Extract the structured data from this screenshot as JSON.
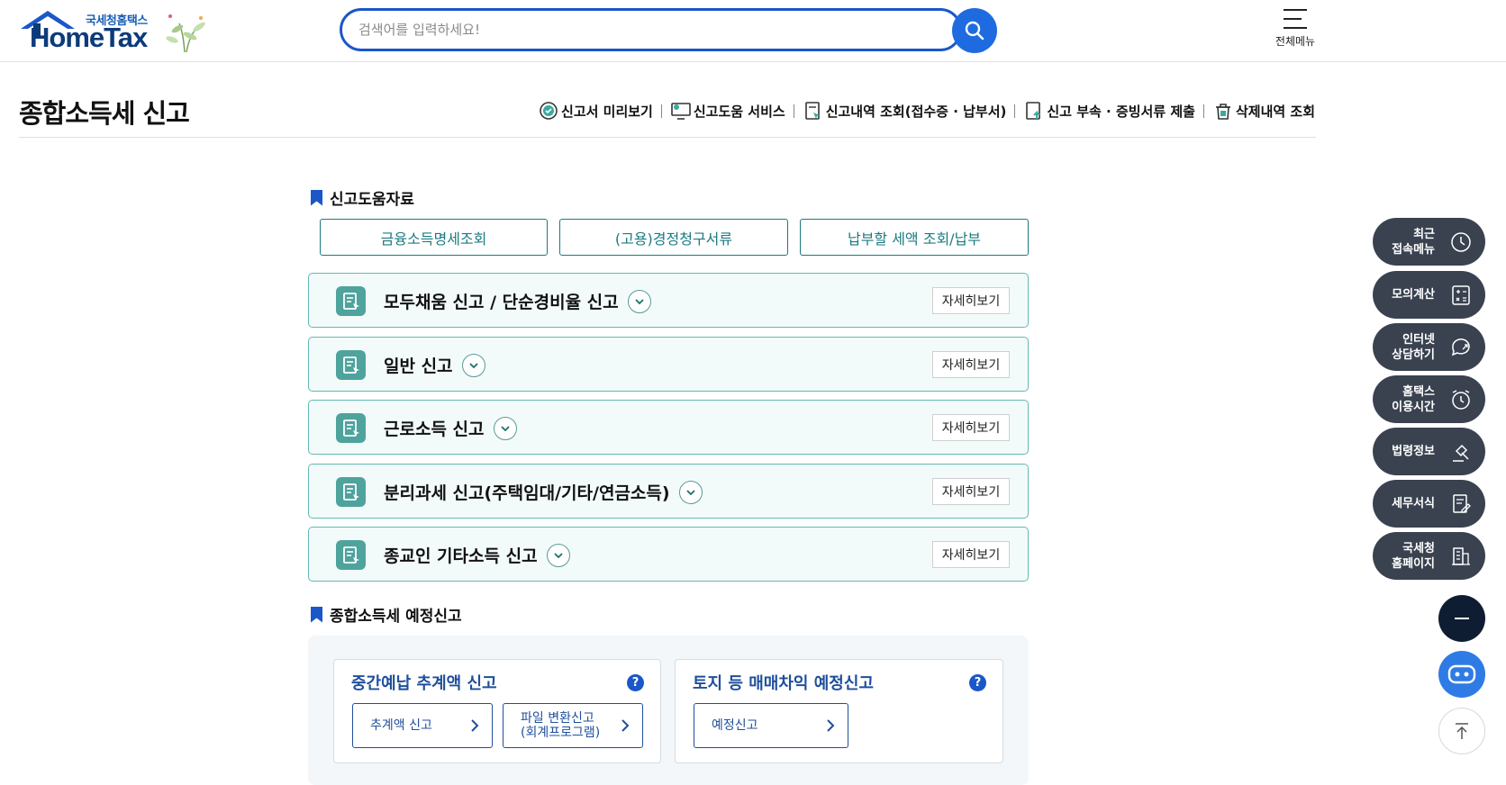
{
  "header": {
    "logo_top_text": "국세청홈택스",
    "logo_main_text": "HomeTax",
    "search_placeholder": "검색어를 입력하세요!",
    "all_menu_label": "전체메뉴"
  },
  "page": {
    "title": "종합소득세 신고",
    "quick_links": [
      {
        "label": "신고서 미리보기",
        "icon": "check-circle-icon"
      },
      {
        "label": "신고도움 서비스",
        "icon": "monitor-help-icon"
      },
      {
        "label": "신고내역 조회(접수증 · 납부서)",
        "icon": "document-search-icon"
      },
      {
        "label": "신고 부속 · 증빙서류 제출",
        "icon": "document-upload-icon"
      },
      {
        "label": "삭제내역 조회",
        "icon": "trash-icon"
      }
    ]
  },
  "help_section": {
    "heading": "신고도움자료",
    "buttons": [
      "금융소득명세조회",
      "(고용)경정청구서류",
      "납부할 세액 조회/납부"
    ]
  },
  "accordions": {
    "more_label": "자세히보기",
    "items": [
      {
        "title": "모두채움 신고 / 단순경비율 신고"
      },
      {
        "title": "일반 신고"
      },
      {
        "title": "근로소득 신고"
      },
      {
        "title": "분리과세 신고(주택임대/기타/연금소득)"
      },
      {
        "title": "종교인 기타소득 신고"
      }
    ]
  },
  "interim_section": {
    "heading": "종합소득세 예정신고",
    "cards": [
      {
        "title": "중간예납 추계액 신고",
        "help": "?",
        "buttons": [
          "추계액 신고",
          "파일 변환신고\n(회계프로그램)"
        ]
      },
      {
        "title": "토지 등 매매차익 예정신고",
        "help": "?",
        "buttons": [
          "예정신고"
        ]
      }
    ]
  },
  "floating_menu": [
    {
      "label": "최근\n접속메뉴",
      "icon": "clock-icon"
    },
    {
      "label": "모의계산",
      "icon": "calculator-icon"
    },
    {
      "label": "인터넷\n상담하기",
      "icon": "chat-icon"
    },
    {
      "label": "홈택스\n이용시간",
      "icon": "alarm-icon"
    },
    {
      "label": "법령정보",
      "icon": "gavel-icon"
    },
    {
      "label": "세무서식",
      "icon": "form-icon"
    },
    {
      "label": "국세청\n홈페이지",
      "icon": "building-icon"
    }
  ],
  "colors": {
    "primary_blue": "#1a57c8",
    "teal": "#4ea39d",
    "floating_bg": "#3a4250",
    "dark_navy": "#0f1d33",
    "chatbot_blue": "#2f7be6"
  }
}
